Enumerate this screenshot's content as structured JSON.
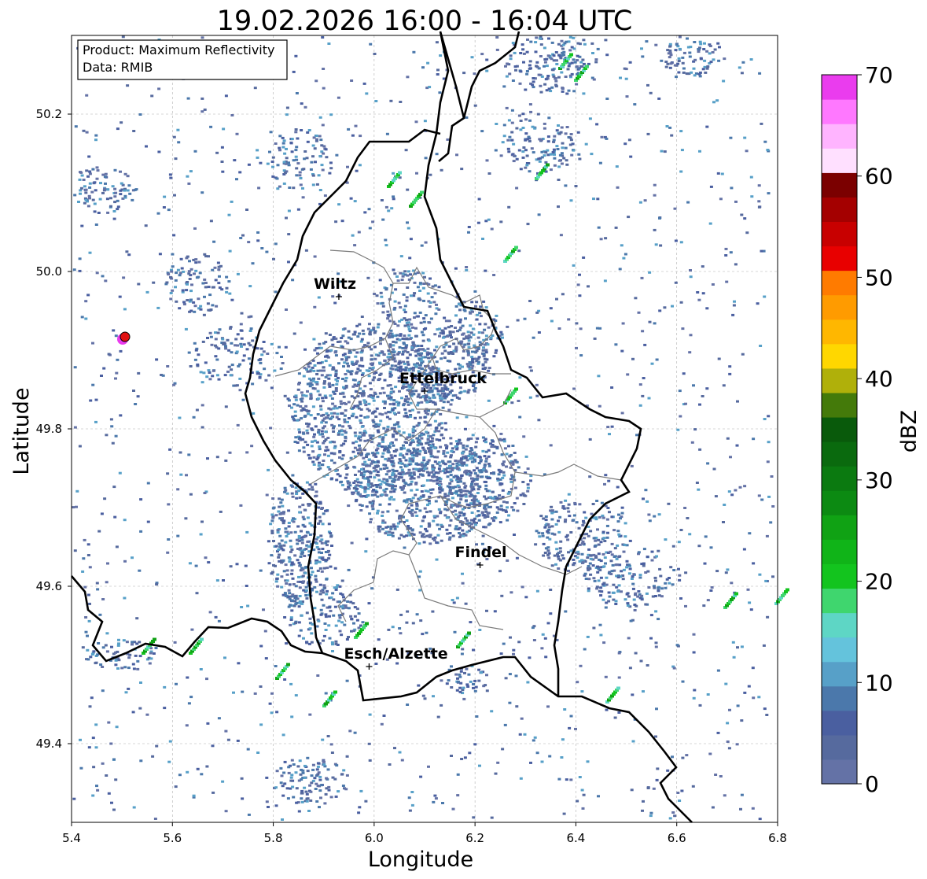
{
  "title": "19.02.2026 16:00 - 16:04 UTC",
  "info_box": {
    "product": "Product: Maximum Reflectivity",
    "data": "Data: RMIB"
  },
  "x_axis": {
    "label": "Longitude",
    "ticks": [
      "5.4",
      "5.6",
      "5.8",
      "6.0",
      "6.2",
      "6.4",
      "6.6",
      "6.8"
    ],
    "range": [
      5.4,
      6.8
    ]
  },
  "y_axis": {
    "label": "Latitude",
    "ticks": [
      "49.4",
      "49.6",
      "49.8",
      "50.0",
      "50.2"
    ],
    "range": [
      49.3,
      50.3
    ]
  },
  "grid": true,
  "colorbar": {
    "label": "dBZ",
    "ticks": [
      "0",
      "10",
      "20",
      "30",
      "40",
      "50",
      "60",
      "70"
    ],
    "range": [
      0,
      70
    ],
    "colors": [
      "#6472a6",
      "#566a9e",
      "#4a5fa0",
      "#4b78ab",
      "#57a0c8",
      "#64c3dc",
      "#5ed6c5",
      "#3fd66e",
      "#13c41e",
      "#10b418",
      "#10a214",
      "#0c8a12",
      "#0b7a10",
      "#0a6a0e",
      "#095a0b",
      "#447a0a",
      "#b0b00a",
      "#ffd700",
      "#ffb700",
      "#ff9b00",
      "#ff7b00",
      "#e80000",
      "#c80000",
      "#a40000",
      "#7b0000",
      "#ffe0ff",
      "#ffb4ff",
      "#ff78ff",
      "#ea3cee"
    ]
  },
  "cities": [
    {
      "name": "Wiltz",
      "lon": 5.93,
      "lat": 49.968
    },
    {
      "name": "Ettelbruck",
      "lon": 6.1,
      "lat": 49.848
    },
    {
      "name": "Findel",
      "lon": 6.21,
      "lat": 49.627
    },
    {
      "name": "Esch/Alzette",
      "lon": 5.99,
      "lat": 49.498
    }
  ],
  "radar_site": {
    "lon": 5.505,
    "lat": 49.915
  }
}
